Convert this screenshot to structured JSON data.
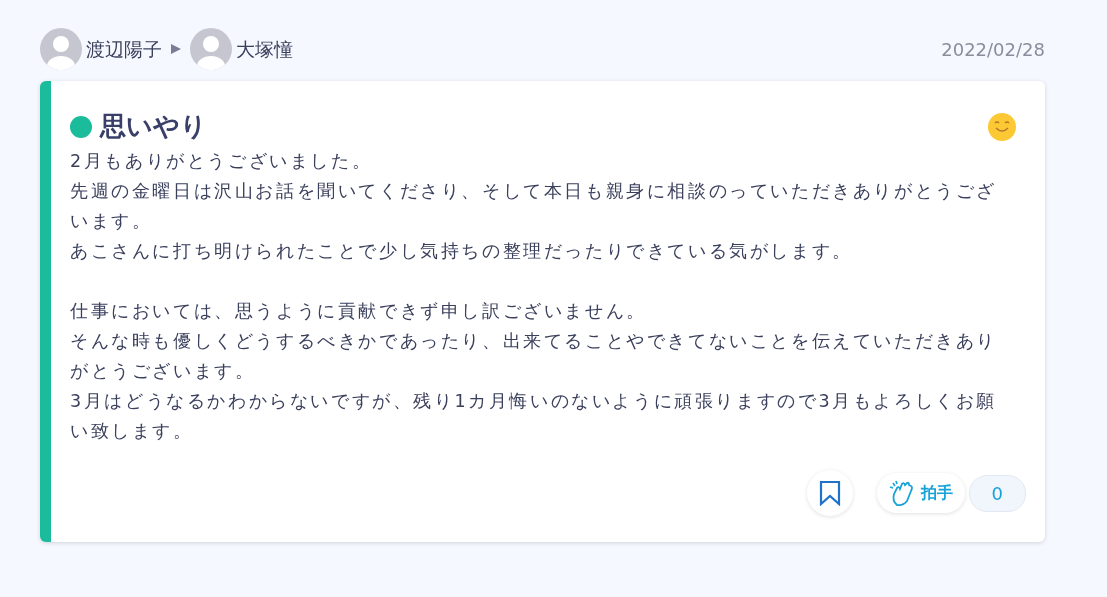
{
  "header": {
    "sender": "渡辺陽子",
    "recipient": "大塚憧",
    "date": "2022/02/28"
  },
  "card": {
    "category": {
      "label": "思いやり",
      "color": "#1abc9c"
    },
    "paragraphs": [
      [
        "2月もありがとうございました。",
        "先週の金曜日は沢山お話を聞いてくださり、そして本日も親身に相談のっていただきありがとうございます。",
        "あこさんに打ち明けられたことで少し気持ちの整理だったりできている気がします。"
      ],
      [
        "仕事においては、思うように貢献できず申し訳ございません。",
        "そんな時も優しくどうするべきかであったり、出来てることやできてないことを伝えていただきありがとうございます。",
        "3月はどうなるかわからないですが、残り1カ月悔いのないように頑張りますので3月もよろしくお願い致します。"
      ]
    ],
    "bookmarked": false,
    "clap": {
      "label": "拍手",
      "count": "0"
    }
  }
}
